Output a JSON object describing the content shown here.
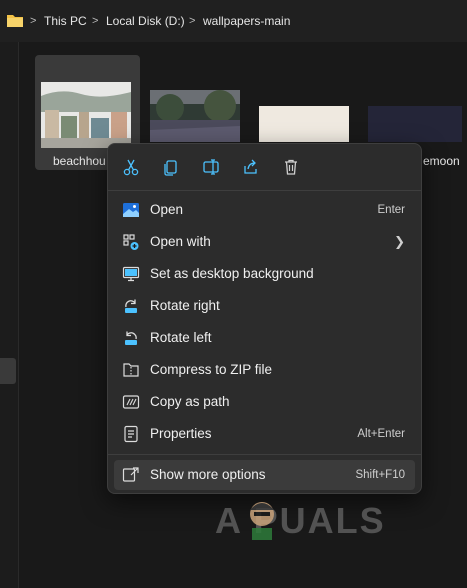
{
  "breadcrumb": {
    "items": [
      "This PC",
      "Local Disk (D:)",
      "wallpapers-main"
    ],
    "separator": ">"
  },
  "files": [
    {
      "name": "beachhou",
      "selected": true
    },
    {
      "name": "",
      "selected": false
    },
    {
      "name": "",
      "selected": false
    },
    {
      "name": "emoon",
      "selected": false
    }
  ],
  "context_menu": {
    "toolbar": [
      {
        "icon": "cut-icon"
      },
      {
        "icon": "copy-icon"
      },
      {
        "icon": "rename-icon"
      },
      {
        "icon": "share-icon"
      },
      {
        "icon": "delete-icon"
      }
    ],
    "items": [
      {
        "label": "Open",
        "shortcut": "Enter",
        "icon": "open-image-icon"
      },
      {
        "label": "Open with",
        "shortcut": "",
        "icon": "open-with-icon",
        "submenu": true
      },
      {
        "label": "Set as desktop background",
        "shortcut": "",
        "icon": "desktop-background-icon"
      },
      {
        "label": "Rotate right",
        "shortcut": "",
        "icon": "rotate-right-icon"
      },
      {
        "label": "Rotate left",
        "shortcut": "",
        "icon": "rotate-left-icon"
      },
      {
        "label": "Compress to ZIP file",
        "shortcut": "",
        "icon": "zip-icon"
      },
      {
        "label": "Copy as path",
        "shortcut": "",
        "icon": "copy-path-icon"
      },
      {
        "label": "Properties",
        "shortcut": "Alt+Enter",
        "icon": "properties-icon"
      }
    ],
    "more": {
      "label": "Show more options",
      "shortcut": "Shift+F10",
      "icon": "show-more-icon"
    }
  },
  "watermark": {
    "text": "A  PUALS"
  },
  "colors": {
    "accent": "#4cc2ff",
    "menu_bg": "#2c2c2c",
    "folder": "#f3c246"
  }
}
